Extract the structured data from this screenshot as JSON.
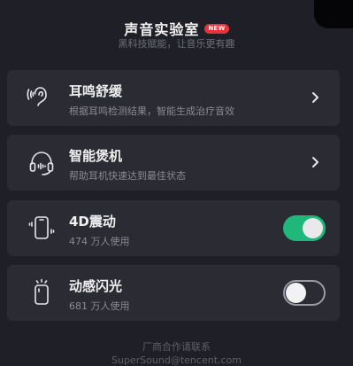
{
  "header": {
    "title": "声音实验室",
    "badge": "NEW",
    "subtitle": "黑科技赋能，让音乐更有趣"
  },
  "items": [
    {
      "title": "耳鸣舒缓",
      "subtitle": "根据耳鸣检测结果，智能生成治疗音效",
      "icon": "ear-sound-icon",
      "control": "chevron"
    },
    {
      "title": "智能煲机",
      "subtitle": "帮助耳机快速达到最佳状态",
      "icon": "headphones-icon",
      "control": "chevron"
    },
    {
      "title": "4D震动",
      "subtitle": "474 万人使用",
      "icon": "phone-vibrate-icon",
      "control": "toggle",
      "enabled": true
    },
    {
      "title": "动感闪光",
      "subtitle": "681 万人使用",
      "icon": "phone-flash-icon",
      "control": "toggle",
      "enabled": false
    }
  ],
  "footer": {
    "line1": "厂商合作请联系",
    "line2": "SuperSound@tencent.com"
  },
  "colors": {
    "background": "#1f1f27",
    "card": "#2b2b33",
    "toggle_on": "#1fb87a",
    "badge": "#e8323c"
  }
}
